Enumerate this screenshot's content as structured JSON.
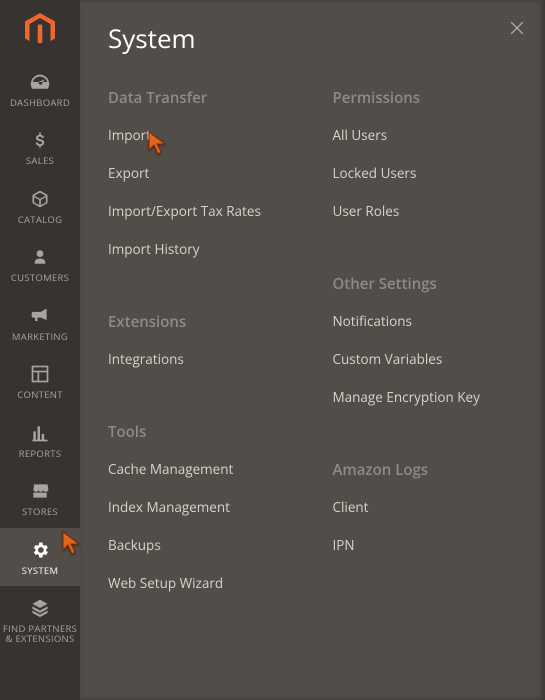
{
  "sidebar": {
    "items": [
      {
        "label": "DASHBOARD"
      },
      {
        "label": "SALES"
      },
      {
        "label": "CATALOG"
      },
      {
        "label": "CUSTOMERS"
      },
      {
        "label": "MARKETING"
      },
      {
        "label": "CONTENT"
      },
      {
        "label": "REPORTS"
      },
      {
        "label": "STORES"
      },
      {
        "label": "SYSTEM"
      },
      {
        "label": "FIND PARTNERS\n& EXTENSIONS"
      }
    ]
  },
  "panel": {
    "title": "System",
    "left_sections": [
      {
        "header": "Data Transfer",
        "items": [
          "Import",
          "Export",
          "Import/Export Tax Rates",
          "Import History"
        ]
      },
      {
        "header": "Extensions",
        "items": [
          "Integrations"
        ]
      },
      {
        "header": "Tools",
        "items": [
          "Cache Management",
          "Index Management",
          "Backups",
          "Web Setup Wizard"
        ]
      }
    ],
    "right_sections": [
      {
        "header": "Permissions",
        "items": [
          "All Users",
          "Locked Users",
          "User Roles"
        ]
      },
      {
        "header": "Other Settings",
        "items": [
          "Notifications",
          "Custom Variables",
          "Manage Encryption Key"
        ]
      },
      {
        "header": "Amazon Logs",
        "items": [
          "Client",
          "IPN"
        ]
      }
    ]
  }
}
